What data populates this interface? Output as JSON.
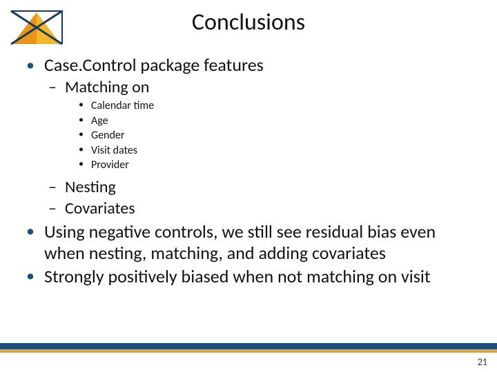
{
  "title": "Conclusions",
  "page_number": "21",
  "colors": {
    "bullet_accent": "#1F4E79",
    "band_top": "#1F4E79",
    "band_bottom": "#E8A33D"
  },
  "bullets": {
    "features_label": "Case.Control package features",
    "matching_label": "Matching on",
    "matching_items": [
      "Calendar time",
      "Age",
      "Gender",
      "Visit dates",
      "Provider"
    ],
    "nesting_label": "Nesting",
    "covariates_label": "Covariates",
    "neg_controls": "Using negative controls, we still see residual bias even when nesting, matching, and adding covariates",
    "strong_bias": "Strongly positively biased when not matching on visit"
  }
}
